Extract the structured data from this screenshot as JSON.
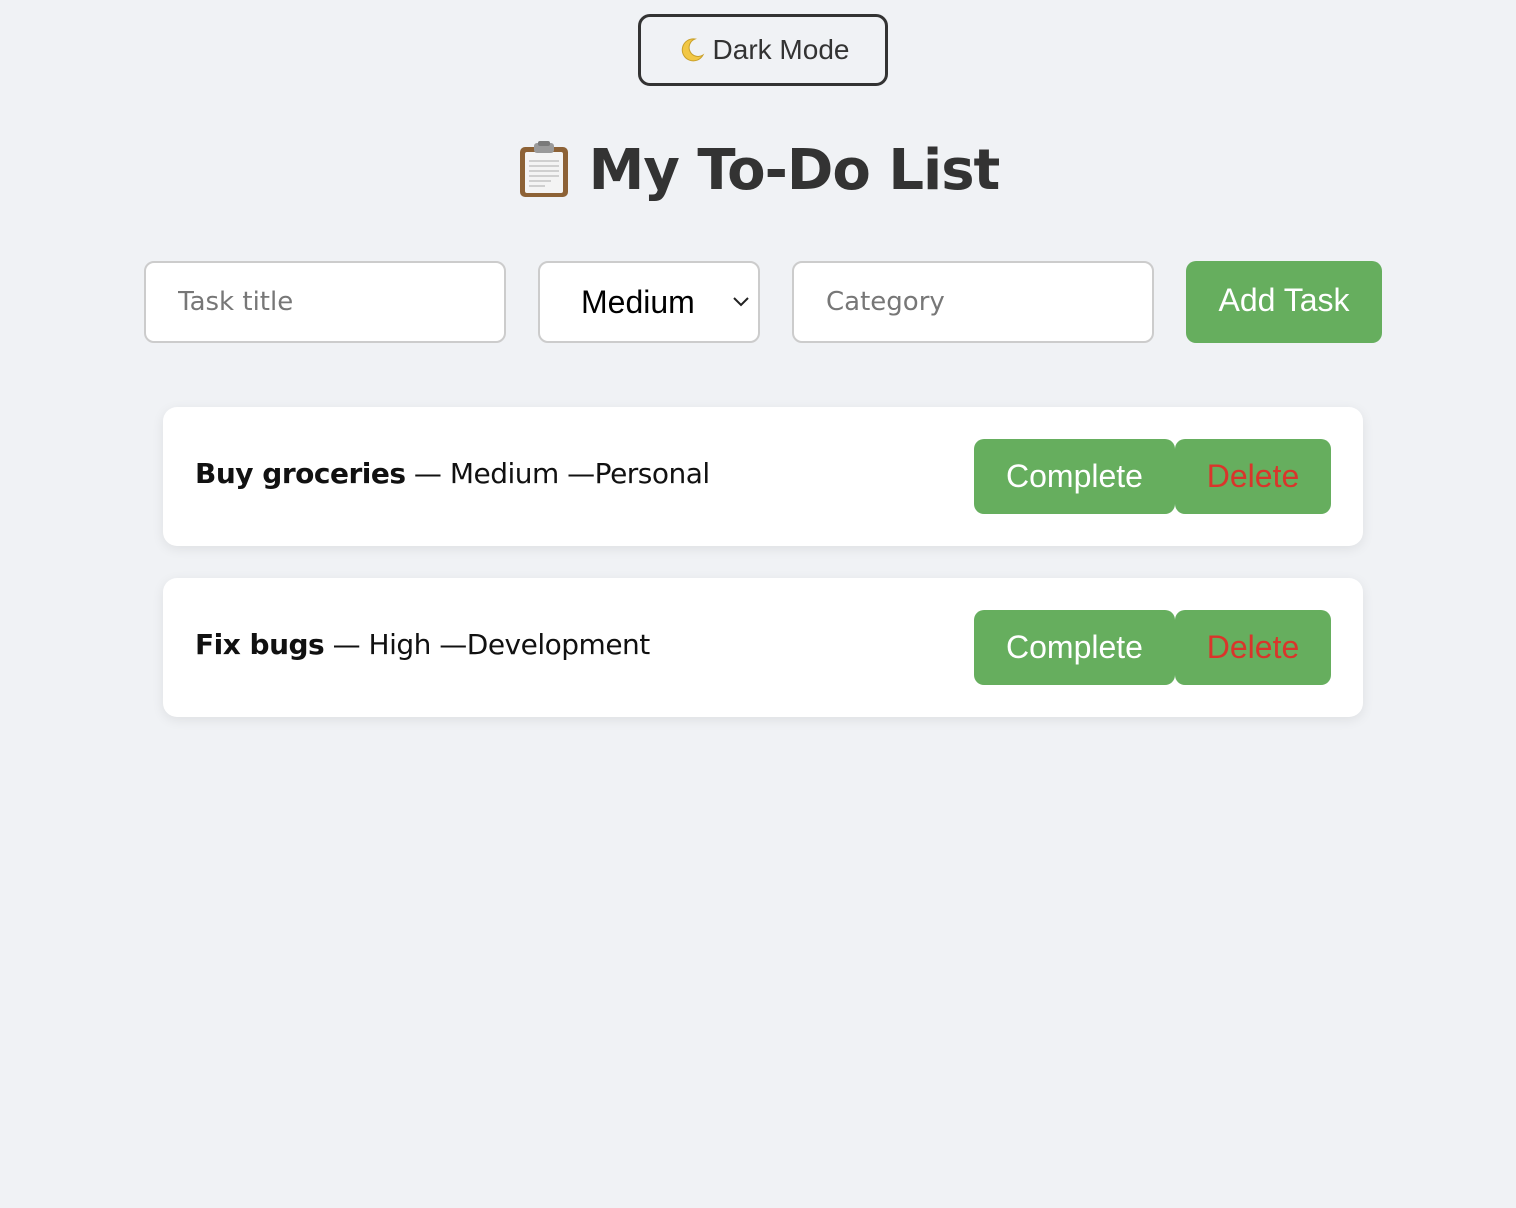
{
  "dark_mode_toggle": {
    "label": "Dark Mode",
    "icon": "moon-icon"
  },
  "header": {
    "title": "My To-Do List",
    "icon": "clipboard-icon"
  },
  "form": {
    "task_placeholder": "Task title",
    "task_value": "",
    "priority_selected": "Medium",
    "category_placeholder": "Category",
    "category_value": "",
    "add_label": "Add Task"
  },
  "tasks": [
    {
      "title": "Buy groceries",
      "meta": " — Medium —Personal",
      "complete_label": "Complete",
      "delete_label": "Delete"
    },
    {
      "title": "Fix bugs",
      "meta": " — High —Development",
      "complete_label": "Complete",
      "delete_label": "Delete"
    }
  ],
  "colors": {
    "background": "#f0f2f5",
    "accent_green": "#66ae5e",
    "delete_red": "#d9352b",
    "text_dark": "#333333"
  }
}
